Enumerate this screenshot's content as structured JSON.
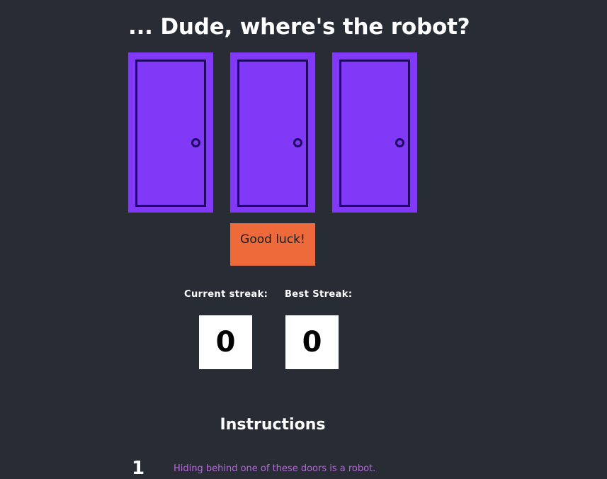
{
  "header": {
    "title": "... Dude, where's the robot?"
  },
  "doors": [
    {
      "name": "door-1"
    },
    {
      "name": "door-2"
    },
    {
      "name": "door-3"
    }
  ],
  "status": {
    "label": "Good luck!",
    "color": "#ee6a3a"
  },
  "scores": {
    "current_label": "Current streak:",
    "current_value": "0",
    "best_label": "Best Streak:",
    "best_value": "0"
  },
  "instructions": {
    "title": "Instructions",
    "items": [
      {
        "number": "1",
        "text": "Hiding behind one of these doors is a robot."
      }
    ]
  },
  "colors": {
    "background": "#282c34",
    "door": "#8138f7",
    "door_outline": "#1e0864",
    "instruction_text": "#b46bd6"
  }
}
